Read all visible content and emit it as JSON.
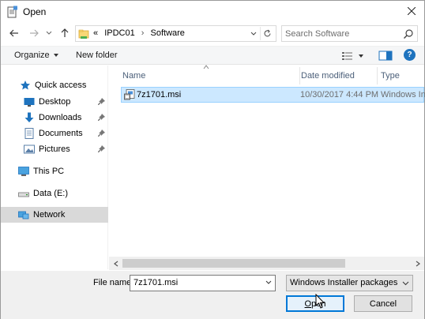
{
  "window": {
    "title": "Open"
  },
  "address": {
    "prefix": "«",
    "crumbs": [
      "IPDC01",
      "Software"
    ]
  },
  "search": {
    "placeholder": "Search Software"
  },
  "toolbar": {
    "organize_label": "Organize",
    "new_folder_label": "New folder"
  },
  "nav": {
    "quick_access": "Quick access",
    "items": [
      {
        "label": "Desktop",
        "pinned": true,
        "icon": "desktop-icon"
      },
      {
        "label": "Downloads",
        "pinned": true,
        "icon": "downloads-icon"
      },
      {
        "label": "Documents",
        "pinned": true,
        "icon": "documents-icon"
      },
      {
        "label": "Pictures",
        "pinned": true,
        "icon": "pictures-icon"
      }
    ],
    "this_pc": "This PC",
    "data_drive": "Data (E:)",
    "network": "Network"
  },
  "columns": {
    "name": "Name",
    "date_modified": "Date modified",
    "type": "Type"
  },
  "files": [
    {
      "name": "7z1701.msi",
      "date_modified": "10/30/2017 4:44 PM",
      "type": "Windows Ins",
      "selected": true
    }
  ],
  "footer": {
    "file_name_label": "File name:",
    "file_name_value": "7z1701.msi",
    "file_type_value": "Windows Installer packages (*.r",
    "open_label_pre": "",
    "open_label_underline": "O",
    "open_label_post": "pen",
    "cancel_label": "Cancel"
  },
  "colors": {
    "selection_bg": "#cce8ff",
    "selection_border": "#99d1ff",
    "accent": "#0078d7",
    "nav_selected": "#d9d9d9",
    "header_text": "#4c607a"
  }
}
